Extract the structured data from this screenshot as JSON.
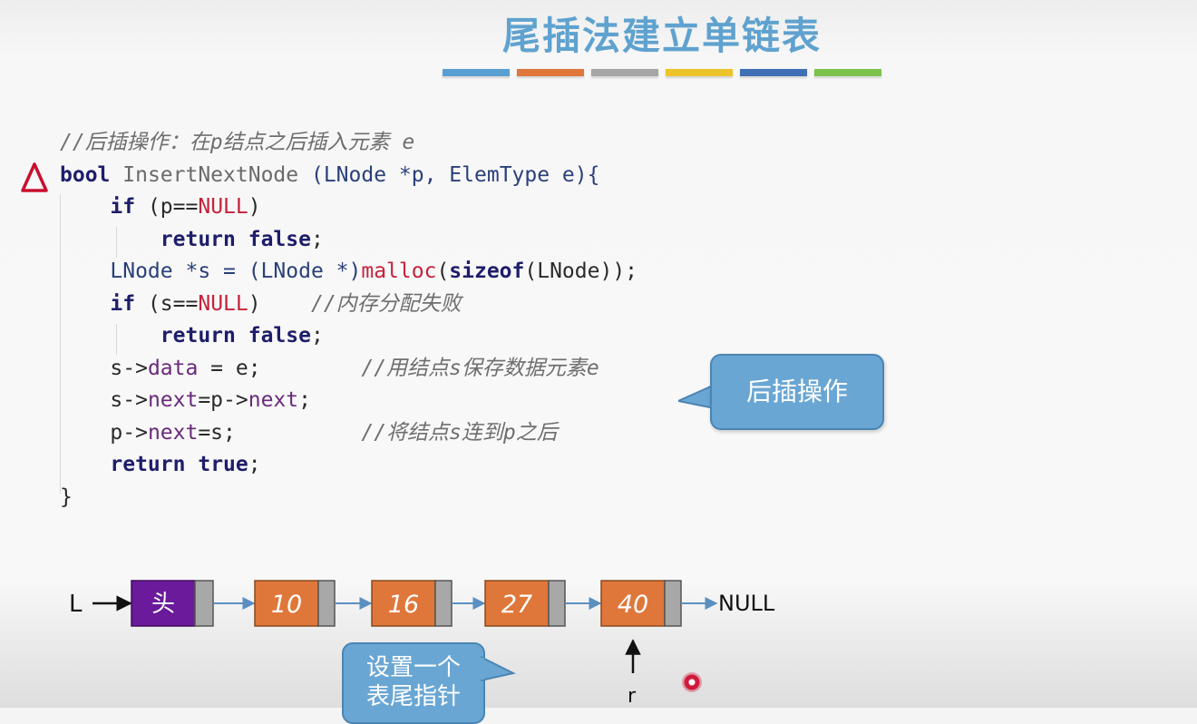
{
  "slide": {
    "title": "尾插法建立单链表",
    "title_color": "#5fa2cf",
    "accent_bar_colors": [
      "#5a9fd4",
      "#e0773a",
      "#a6a6a6",
      "#ecc32a",
      "#3f6fb4",
      "#7cc24a"
    ]
  },
  "code": {
    "comment_header": "//后插操作：在p结点之后插入元素 e",
    "signature": {
      "ret": "bool",
      "name": "InsertNextNode",
      "params": "(LNode *p, ElemType e){"
    },
    "if1": {
      "kw": "if",
      "open": "(p==",
      "null": "NULL",
      "close": ")"
    },
    "return_false_1": {
      "kw": "return",
      "val": "false",
      "semi": ";"
    },
    "malloc_line": {
      "lhs": "LNode *s = (LNode *)",
      "fn": "malloc",
      "open": "(",
      "kw": "sizeof",
      "rest": "(LNode));"
    },
    "if2": {
      "kw": "if",
      "open": "(s==",
      "null": "NULL",
      "close": ")",
      "comment": "//内存分配失败"
    },
    "return_false_2": {
      "kw": "return",
      "val": "false",
      "semi": ";"
    },
    "assign_data": {
      "a": "s->",
      "field": "data",
      "b": " = e;",
      "comment": "//用结点s保存数据元素e"
    },
    "assign_next": {
      "a": "s->",
      "field": "next",
      "b": "=p->",
      "field2": "next",
      "c": ";"
    },
    "link": {
      "a": "p->",
      "field": "next",
      "b": "=s;",
      "comment": "//将结点s连到p之后"
    },
    "return_true": {
      "kw": "return",
      "val": "true",
      "semi": ";"
    },
    "closing_brace": "}"
  },
  "callout_main": {
    "text": "后插操作"
  },
  "diagram": {
    "head_pointer_label": "L",
    "head_node_label": "头",
    "nodes": [
      "10",
      "16",
      "27",
      "40"
    ],
    "null_label": "NULL",
    "tail_pointer_label": "r",
    "head_color": "#6a1a9a",
    "node_color": "#e0773a",
    "link_color": "#5a8fc0"
  },
  "callout_tail": {
    "line1": "设置一个",
    "line2": "表尾指针"
  },
  "icons": {
    "warning": "warning-triangle-icon",
    "cursor": "cursor-dot-icon"
  }
}
